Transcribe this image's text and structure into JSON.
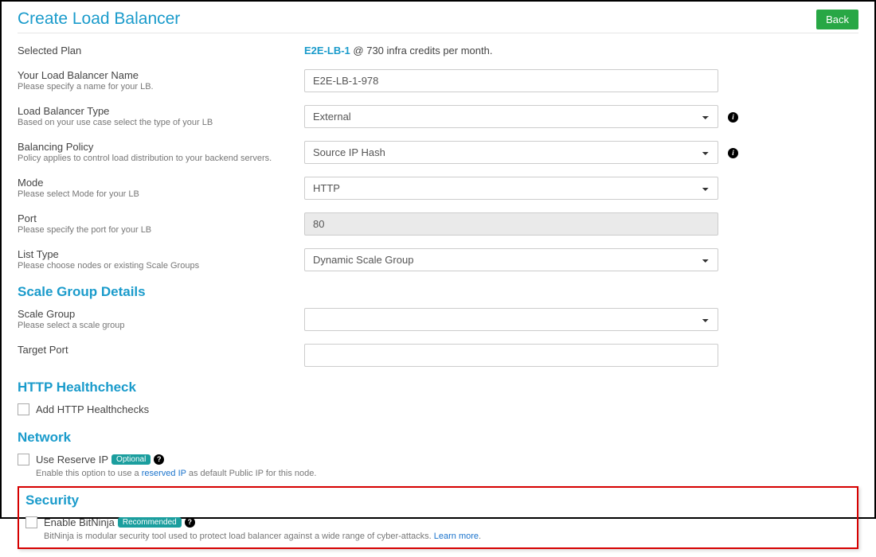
{
  "header": {
    "title": "Create Load Balancer",
    "back_label": "Back"
  },
  "plan": {
    "label": "Selected Plan",
    "name": "E2E-LB-1",
    "suffix": " @ 730 infra credits per month."
  },
  "name": {
    "label": "Your Load Balancer Name",
    "sub": "Please specify a name for your LB.",
    "value": "E2E-LB-1-978"
  },
  "lbtype": {
    "label": "Load Balancer Type",
    "sub": "Based on your use case select the type of your LB",
    "value": "External"
  },
  "policy": {
    "label": "Balancing Policy",
    "sub": "Policy applies to control load distribution to your backend servers.",
    "value": "Source IP Hash"
  },
  "mode": {
    "label": "Mode",
    "sub": "Please select Mode for your LB",
    "value": "HTTP"
  },
  "port": {
    "label": "Port",
    "sub": "Please specify the port for your LB",
    "value": "80"
  },
  "listtype": {
    "label": "List Type",
    "sub": "Please choose nodes or existing Scale Groups",
    "value": "Dynamic Scale Group"
  },
  "scalegroup": {
    "section_title": "Scale Group Details",
    "label": "Scale Group",
    "sub": "Please select a scale group",
    "value": "",
    "target_port_label": "Target Port",
    "target_port_value": ""
  },
  "healthcheck": {
    "section_title": "HTTP Healthcheck",
    "checkbox_label": "Add HTTP Healthchecks"
  },
  "network": {
    "section_title": "Network",
    "checkbox_label": "Use Reserve IP",
    "badge": "Optional",
    "hint_prefix": "Enable this option to use a ",
    "hint_link": "reserved IP",
    "hint_suffix": " as default Public IP for this node."
  },
  "security": {
    "section_title": "Security",
    "checkbox_label": "Enable BitNinja",
    "badge": "Recommended",
    "hint_text": "BitNinja is modular security tool used to protect load balancer against a wide range of cyber-attacks. ",
    "learn_more": "Learn more"
  }
}
